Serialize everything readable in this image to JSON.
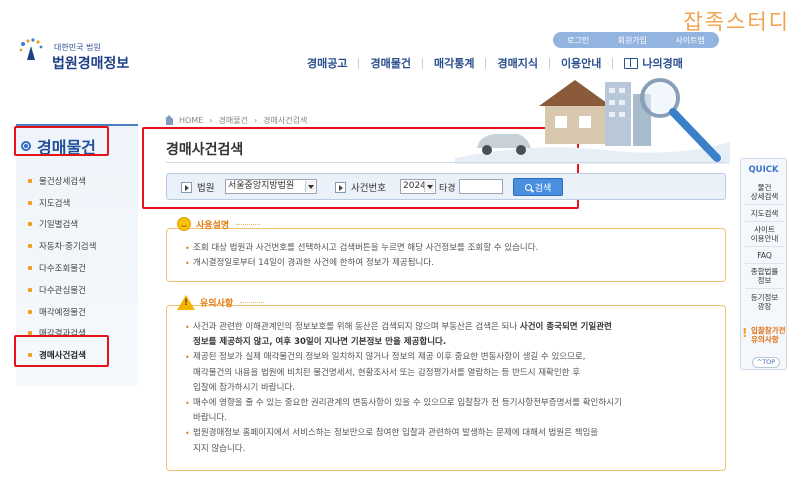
{
  "watermark": "잡족스터디",
  "header": {
    "logo_small": "대한민국 법원",
    "logo_title": "법원경매정보",
    "util_links": [
      "로그인",
      "회원가입",
      "사이트맵"
    ],
    "nav": [
      "경매공고",
      "경매물건",
      "매각통계",
      "경매지식",
      "이용안내"
    ],
    "mypage": "나의경매"
  },
  "sidebar": {
    "title": "경매물건",
    "items": [
      "물건상세검색",
      "지도검색",
      "기일별검색",
      "자동차·중기검색",
      "다수조회물건",
      "다수관심물건",
      "매각예정물건",
      "매각결과검색",
      "경매사건검색"
    ]
  },
  "breadcrumb": [
    "HOME",
    "경매물건",
    "경매사건검색"
  ],
  "content": {
    "title": "경매사건검색",
    "search": {
      "court_label": "법원",
      "court_value": "서울중앙지방법원",
      "case_label": "사건번호",
      "year_value": "2024",
      "type_label": "타경",
      "case_number": "",
      "button": "검색"
    }
  },
  "usage": {
    "heading": "사용설명",
    "lines": [
      "조회 대상 법원과 사건번호를 선택하시고 검색버튼을 누르면 해당 사건정보를 조회할 수 있습니다.",
      "개시결정일로부터 14일이 경과한 사건에 한하여 정보가 제공됩니다."
    ]
  },
  "caution": {
    "heading": "유의사항",
    "item1_a": "사건과 관련한 이해관계인의 정보보호를 위해 동산은 검색되지 않으며 부동산은 검색은 되나 ",
    "item1_b": "사건이 종국되면 기일관련",
    "item1_c": "정보를 제공하지 않고, 여후 30일이 지나면 기본정보 만을 제공합니다.",
    "item2_a": "제공된 정보가 실제 매각물건의 정보와 일치하지 않거나 정보의 제공 이후 중요한 변동사항이 생길 수 있으므로,",
    "item2_b": "매각물건의 내용을 법원에 비치된 물건명세서, 현황조사서 또는 감정평가서를 열람하는 등 반드시 재확인한 후",
    "item2_c": "입찰에 참가하시기 바랍니다.",
    "item3_a": "매수에 영향을 줄 수 있는 중요한 권리관계의 변동사항이 있을 수 있으므로 입찰참가 전 등기사항전부증명서를 확인하시기",
    "item3_b": "바랍니다.",
    "item4_a": "법원경매정보 홈페이지에서 서비스하는 정보만으로 참여한 입찰과 관련하여 발생하는 문제에 대해서 법원은 책임을",
    "item4_b": "지지 않습니다."
  },
  "quick": {
    "title": "QUICK",
    "items": [
      [
        "물건",
        "상세검색"
      ],
      [
        "지도검색"
      ],
      [
        "사이트",
        "이용안내"
      ],
      [
        "FAQ"
      ],
      [
        "종합법률",
        "정보"
      ],
      [
        "등기정보",
        "광장"
      ]
    ],
    "notice": [
      "입찰참가전",
      "유의사항"
    ],
    "top": "^TOP"
  }
}
